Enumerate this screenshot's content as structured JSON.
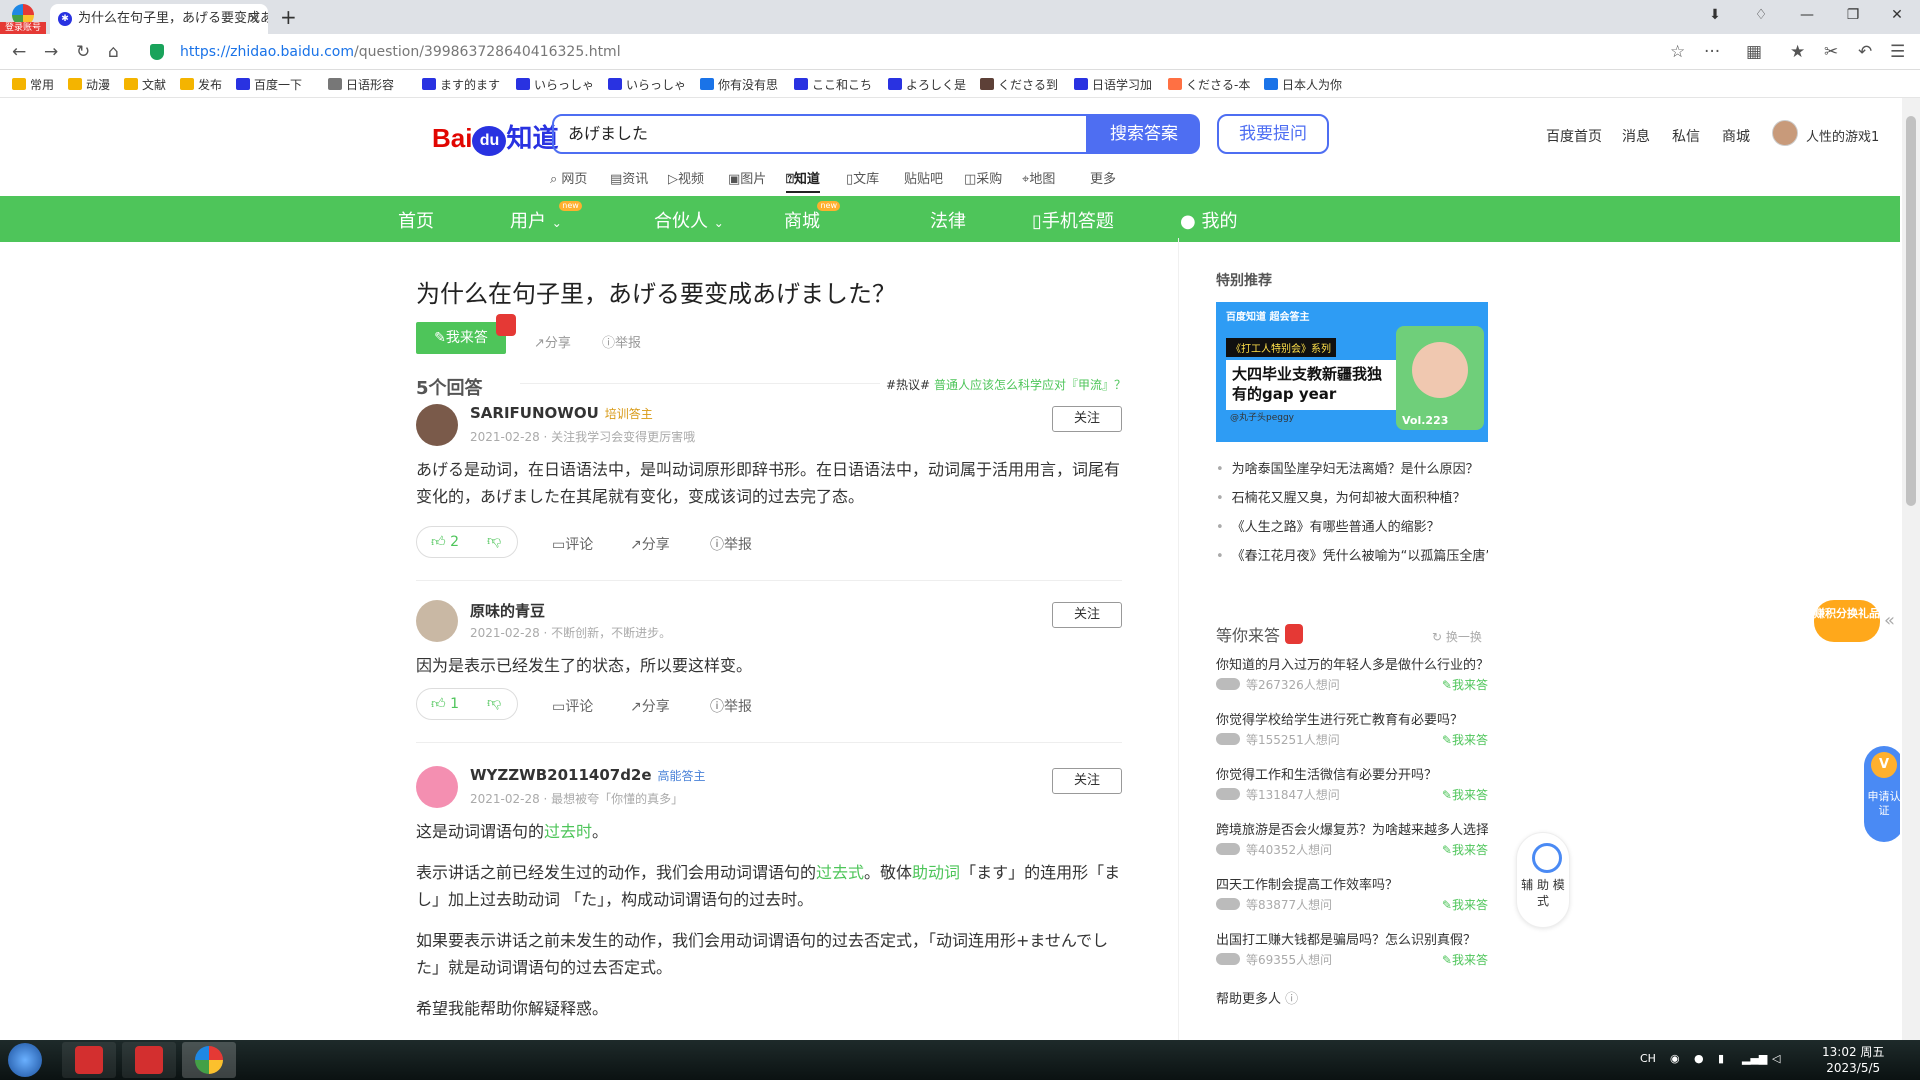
{
  "browser": {
    "badge_label": "登录账号",
    "tab_title": "为什么在句子里，あげる要变成あげました？",
    "url_host": "https://zhidao.baidu.com",
    "url_path": "/question/399863728640416325.html",
    "bookmarks": [
      "常用",
      "动漫",
      "文献",
      "发布",
      "百度一下",
      "日语形容",
      "ます的ます",
      "いらっしゃ",
      "いらっしゃ",
      "你有没有思",
      "ここ和こち",
      "よろしく是",
      "くださる到",
      "日语学习加",
      "くださる-本",
      "日本人为你"
    ]
  },
  "header": {
    "logo": "Bai",
    "logo_du": "du",
    "logo_suffix": "知道",
    "search_value": "あげました",
    "search_button": "搜索答案",
    "ask_button": "我要提问",
    "links": [
      "百度首页",
      "消息",
      "私信",
      "商城"
    ],
    "username": "人性的游戏1",
    "subnav": [
      "网页",
      "资讯",
      "视频",
      "图片",
      "知道",
      "文库",
      "贴吧",
      "采购",
      "地图",
      "更多"
    ],
    "subnav_active": "知道"
  },
  "greenbar": {
    "items": [
      "首页",
      "用户",
      "合伙人",
      "商城",
      "法律",
      "手机答题",
      "我的"
    ],
    "new_badge": "new"
  },
  "question": {
    "title": "为什么在句子里，あげる要变成あげました？",
    "answer_button": "我来答",
    "share": "分享",
    "report": "举报",
    "answer_count": "5个回答",
    "hot_prefix": "#热议#",
    "hot_link": "普通人应该怎么科学应对『甲流』？"
  },
  "answers": [
    {
      "user": "SARIFUNOWOU",
      "badge": "培训答主",
      "meta": "2021-02-28 · 关注我学习会变得更厉害哦",
      "follow": "关注",
      "body": "あげる是动词，在日语语法中，是叫动词原形即辞书形。在日语语法中，动词属于活用用言，词尾有变化的，あげました在其尾就有变化，变成该词的过去完了态。",
      "likes": "2"
    },
    {
      "user": "原味的青豆",
      "badge": "",
      "meta": "2021-02-28 · 不断创新，不断进步。",
      "follow": "关注",
      "body": "因为是表示已经发生了的状态，所以要这样变。",
      "likes": "1"
    },
    {
      "user": "WYZZWB2011407d2e",
      "badge": "高能答主",
      "meta": "2021-02-28 · 最想被夸「你懂的真多」",
      "follow": "关注",
      "p1_before": "这是动词谓语句的",
      "p1_link": "过去时",
      "p1_after": "。",
      "p2_a": "表示讲话之前已经发生过的动作，我们会用动词谓语句的",
      "p2_link1": "过去式",
      "p2_b": "。敬体",
      "p2_link2": "助动词",
      "p2_c": "「ます」的连用形「まし」加上过去助动词 「た」，构成动词谓语句的过去时。",
      "p3": "如果要表示讲话之前未发生的动作，我们会用动词谓语句的过去否定式，「动词连用形+ませんでした」就是动词谓语句的过去否定式。",
      "p4": "希望我能帮助你解疑释惑。"
    }
  ],
  "answer_actions": {
    "comment": "评论",
    "share": "分享",
    "report": "举报"
  },
  "sidebar": {
    "special_title": "特别推荐",
    "banner": {
      "top": "百度知道 超会答主",
      "series": "《打工人特别会》系列",
      "title": "大四毕业支教新疆我独有的gap year",
      "author": "@丸子头peggy",
      "vol": "Vol.223"
    },
    "recommended": [
      "为啥泰国坠崖孕妇无法离婚？是什么原因？",
      "石楠花又腥又臭，为何却被大面积种植？",
      "《人生之路》有哪些普通人的缩影？",
      "《春江花月夜》凭什么被喻为“以孤篇压全唐”？"
    ],
    "waiting_title": "等你来答",
    "swap": "换一换",
    "waiting": [
      {
        "q": "你知道的月入过万的年轻人多是做什么行业的？",
        "w": "等267326人想问"
      },
      {
        "q": "你觉得学校给学生进行死亡教育有必要吗？",
        "w": "等155251人想问"
      },
      {
        "q": "你觉得工作和生活微信有必要分开吗？",
        "w": "等131847人想问"
      },
      {
        "q": "跨境旅游是否会火爆复苏？为啥越来越多人选择？",
        "w": "等40352人想问"
      },
      {
        "q": "四天工作制会提高工作效率吗？",
        "w": "等83877人想问"
      },
      {
        "q": "出国打工赚大钱都是骗局吗？怎么识别真假？",
        "w": "等69355人想问"
      }
    ],
    "answer_link": "我来答",
    "help_more": "帮助更多人"
  },
  "floats": {
    "points": "赚积分换礼品",
    "certify": "申请认证",
    "assist": "辅 助 模 式"
  },
  "taskbar": {
    "time": "13:02 周五",
    "date": "2023/5/5",
    "ime": "CH"
  }
}
